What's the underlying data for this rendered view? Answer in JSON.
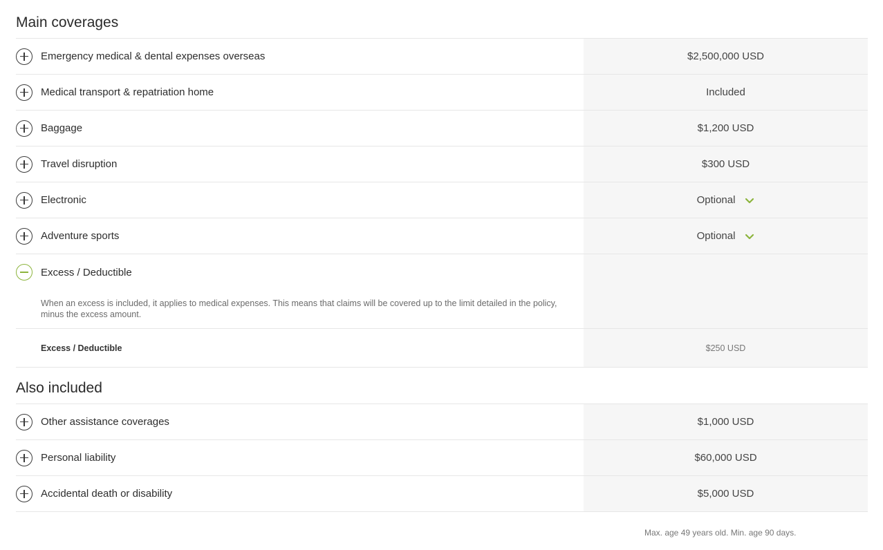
{
  "main": {
    "title": "Main coverages",
    "rows": [
      {
        "label": "Emergency medical & dental expenses overseas",
        "value": "$2,500,000 USD",
        "chevron": false
      },
      {
        "label": "Medical transport & repatriation home",
        "value": "Included",
        "chevron": false
      },
      {
        "label": "Baggage",
        "value": "$1,200 USD",
        "chevron": false
      },
      {
        "label": "Travel disruption",
        "value": "$300 USD",
        "chevron": false
      },
      {
        "label": "Electronic",
        "value": "Optional",
        "chevron": true
      },
      {
        "label": "Adventure sports",
        "value": "Optional",
        "chevron": true
      }
    ],
    "expanded": {
      "label": "Excess / Deductible",
      "description": "When an excess is included, it applies to medical expenses. This means that claims will be covered up to the limit detailed in the policy, minus the excess amount.",
      "sub_label": "Excess / Deductible",
      "sub_value": "$250 USD"
    }
  },
  "also": {
    "title": "Also included",
    "rows": [
      {
        "label": "Other assistance coverages",
        "value": "$1,000 USD"
      },
      {
        "label": "Personal liability",
        "value": "$60,000 USD"
      },
      {
        "label": "Accidental death or disability",
        "value": "$5,000 USD"
      }
    ]
  },
  "footnote": "Max. age 49 years old. Min. age 90 days.",
  "colors": {
    "accent": "#8cb43c",
    "value_bg": "#f6f6f6",
    "divider": "#e6e6e6"
  }
}
